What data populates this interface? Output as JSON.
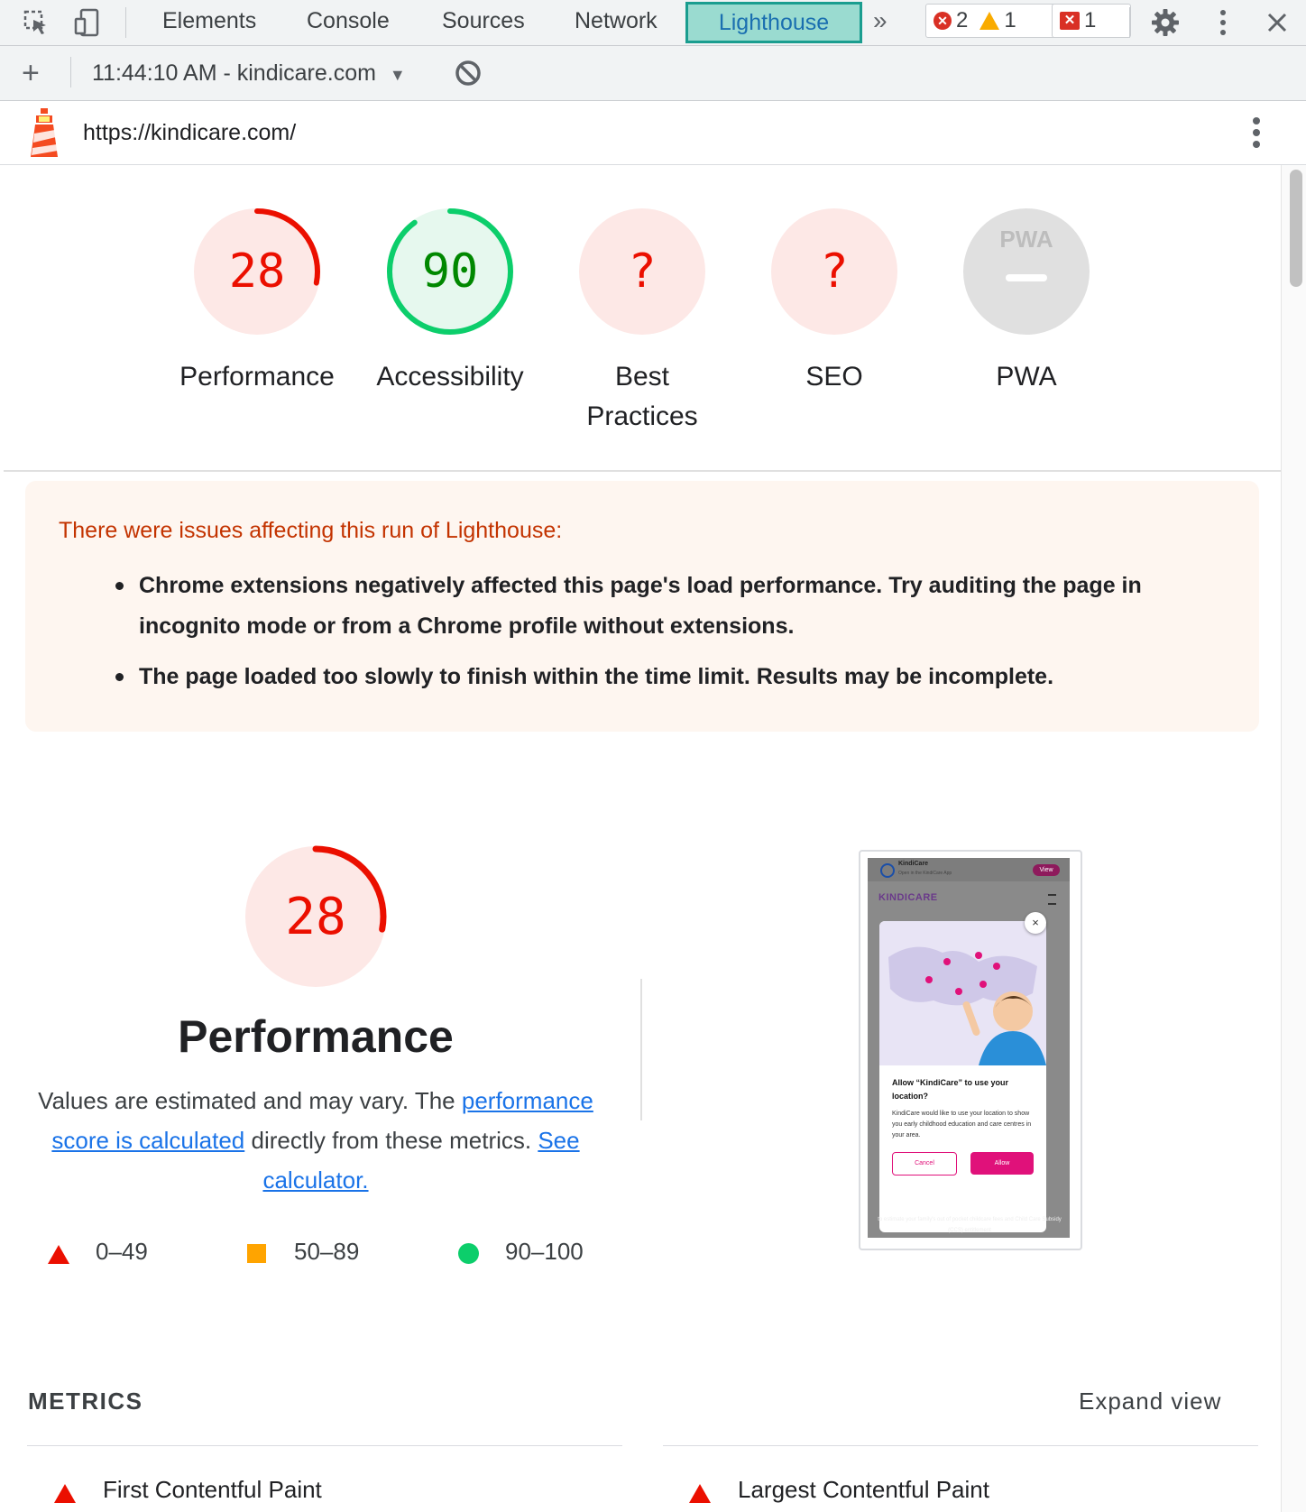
{
  "devtools": {
    "tabs": [
      "Elements",
      "Console",
      "Sources",
      "Network",
      "Lighthouse"
    ],
    "more_tabs": "»",
    "errors_count": "2",
    "warnings_count": "1",
    "issues_count": "1"
  },
  "toolbar": {
    "add_label": "+",
    "report_select": "11:44:10 AM - kindicare.com",
    "dropdown_arrow": "▼"
  },
  "report": {
    "url": "https://kindicare.com/"
  },
  "categories": [
    {
      "label": "Performance",
      "score": "28",
      "fraction": 0.28,
      "status": "fail"
    },
    {
      "label": "Accessibility",
      "score": "90",
      "fraction": 0.9,
      "status": "pass"
    },
    {
      "label": "Best Practices",
      "score": "?",
      "fraction": 0,
      "status": "error"
    },
    {
      "label": "SEO",
      "score": "?",
      "fraction": 0,
      "status": "error"
    },
    {
      "label": "PWA",
      "score": "PWA",
      "fraction": 0,
      "status": "na"
    }
  ],
  "warnings": {
    "title": "There were issues affecting this run of Lighthouse:",
    "items": [
      "Chrome extensions negatively affected this page's load performance. Try auditing the page in incognito mode or from a Chrome profile without extensions.",
      "The page loaded too slowly to finish within the time limit. Results may be incomplete."
    ]
  },
  "performance": {
    "score": "28",
    "fraction": 0.28,
    "title": "Performance",
    "desc_1": "Values are estimated and may vary. The ",
    "link_1": "performance score is calculated",
    "desc_2": " directly from these metrics. ",
    "link_2": "See calculator."
  },
  "legend": [
    {
      "range": "0–49",
      "shape": "triangle",
      "color": "#eb0f00"
    },
    {
      "range": "50–89",
      "shape": "square",
      "color": "#ffa400"
    },
    {
      "range": "90–100",
      "shape": "circle",
      "color": "#0cce6b"
    }
  ],
  "screenshot": {
    "app_name": "KindiCare",
    "app_sub": "Open in the KindiCare App",
    "view_btn": "View",
    "logo_text": "KINDICARE",
    "dialog_title": "Allow “KindiCare” to use your location?",
    "dialog_body": "KindiCare would like to use your location to show you early childhood education and care centres in your area.",
    "cancel": "Cancel",
    "allow": "Allow",
    "footer": "to estimate your family's out of pocket childcare fees and Child Care Subsidy (CCS) entitlement"
  },
  "metrics": {
    "label": "METRICS",
    "expand": "Expand view",
    "items": [
      "First Contentful Paint",
      "Largest Contentful Paint"
    ]
  },
  "colors": {
    "fail": "#eb0f00",
    "fail_bg": "#fde8e6",
    "pass": "#0cce6b",
    "pass_text": "#008800",
    "pass_bg": "#e6f8ee",
    "na_bg": "#e0e0e0",
    "accent_tab": "#9adbd0",
    "warn_bg": "#fef6f0"
  }
}
